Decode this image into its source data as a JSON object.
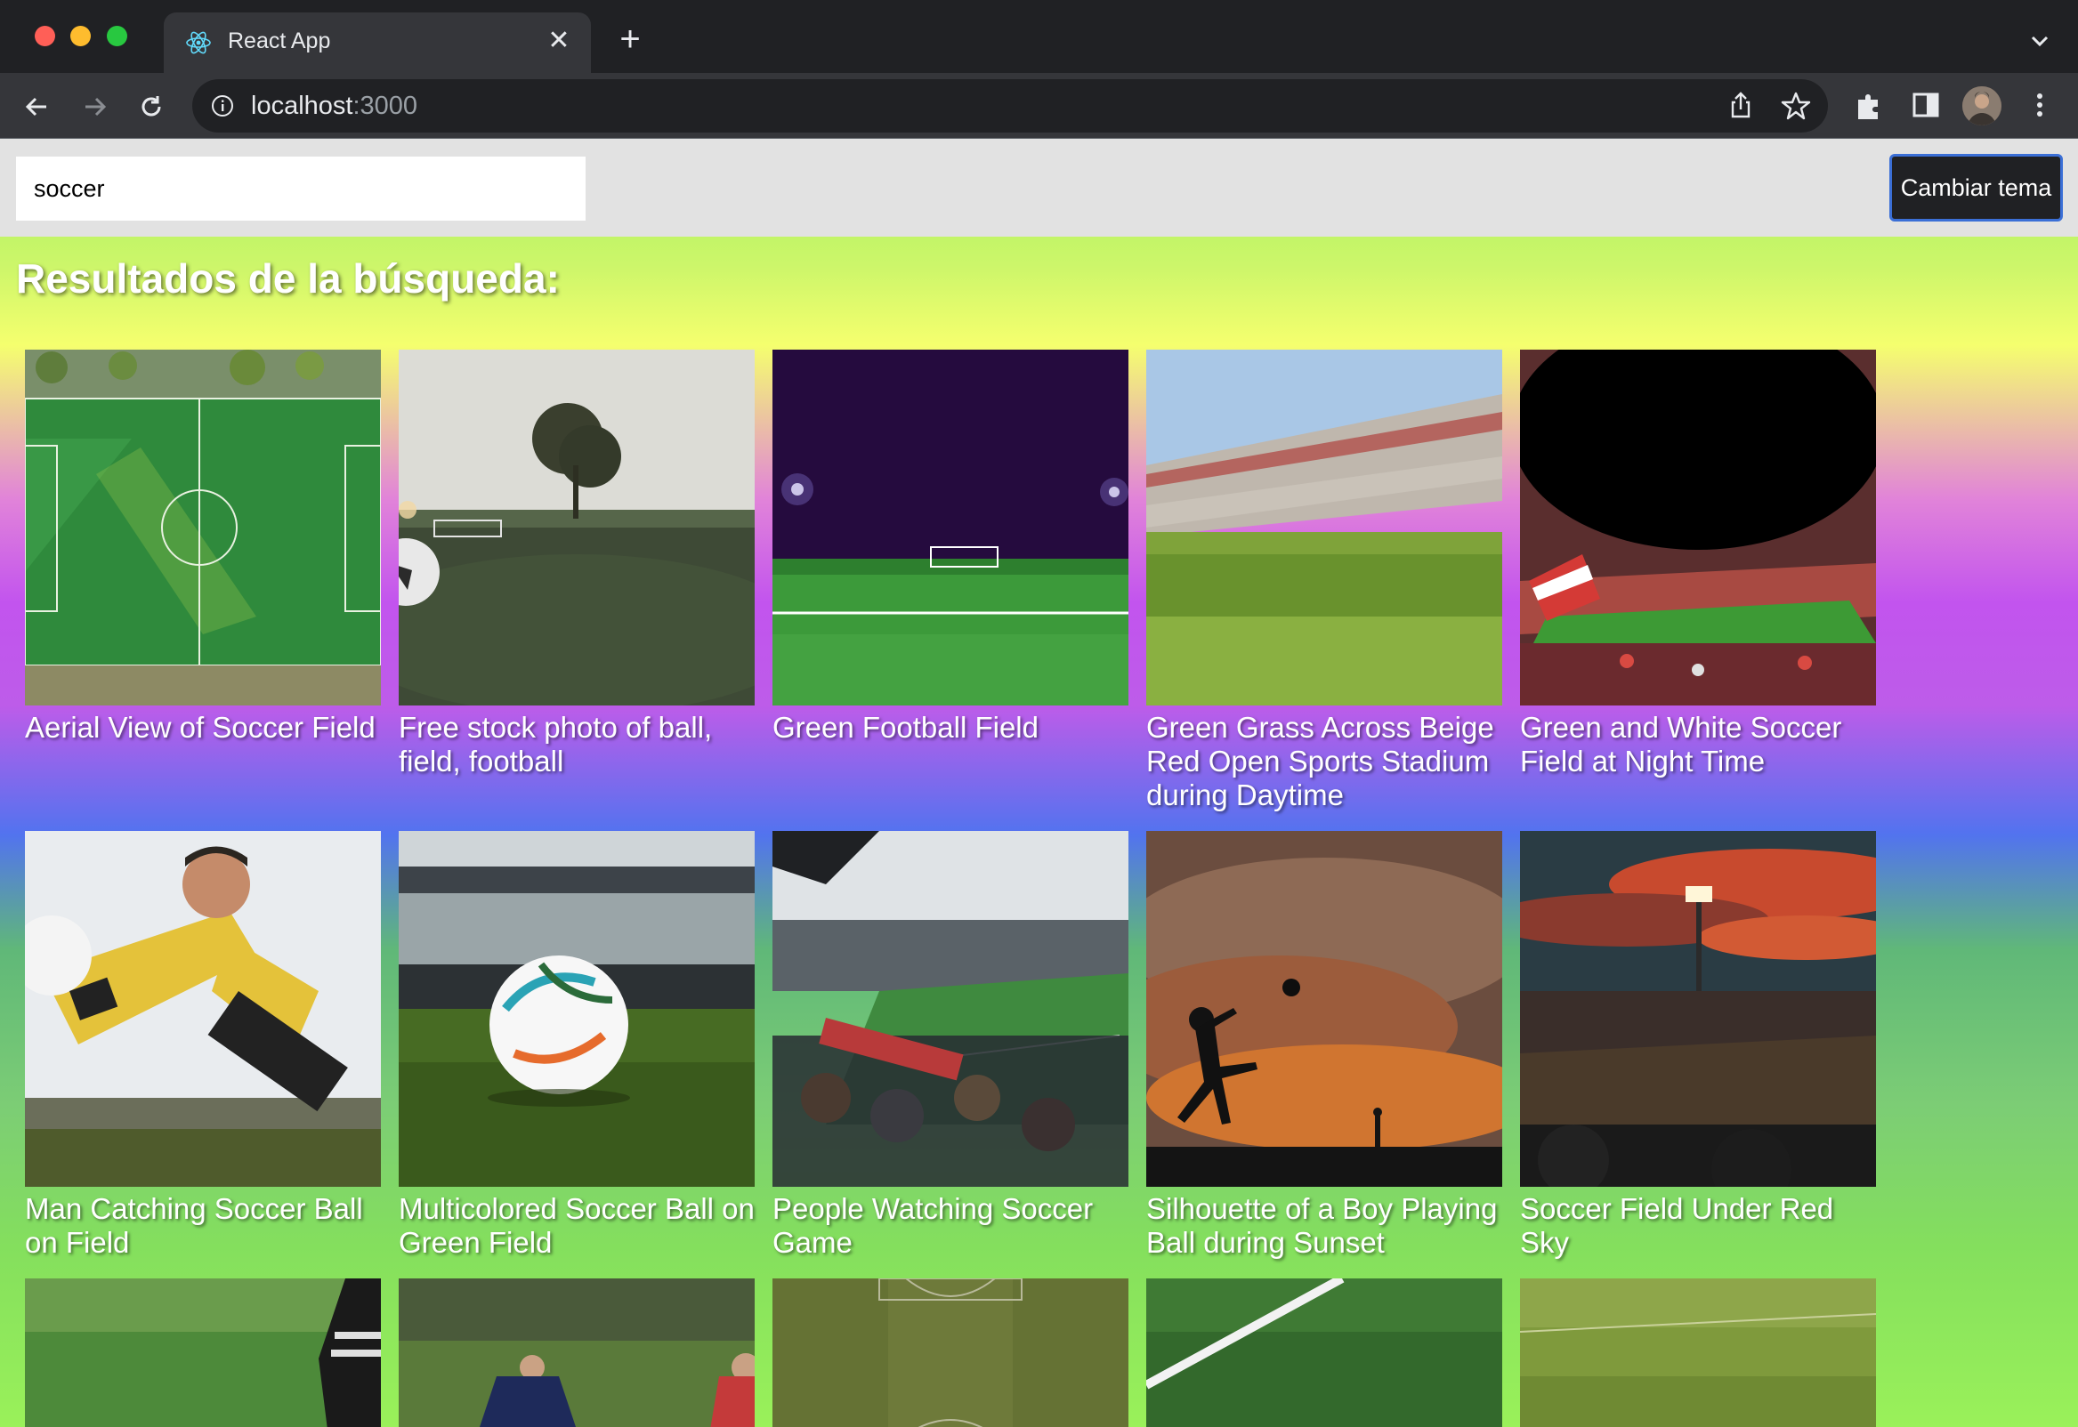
{
  "browser": {
    "tab_title": "React App",
    "url_host": "localhost",
    "url_port": ":3000"
  },
  "search": {
    "value": "soccer",
    "placeholder": ""
  },
  "theme_button_label": "Cambiar tema",
  "results_heading": "Resultados de la búsqueda:",
  "results": [
    {
      "title": "Aerial View of Soccer Field"
    },
    {
      "title": "Free stock photo of ball, field, football"
    },
    {
      "title": "Green Football Field"
    },
    {
      "title": "Green Grass Across Beige Red Open Sports Stadium during Daytime"
    },
    {
      "title": "Green and White Soccer Field at Night Time"
    },
    {
      "title": "Man Catching Soccer Ball on Field"
    },
    {
      "title": "Multicolored Soccer Ball on Green Field"
    },
    {
      "title": "People Watching Soccer Game"
    },
    {
      "title": "Silhouette of a Boy Playing Ball during Sunset"
    },
    {
      "title": "Soccer Field Under Red Sky"
    }
  ],
  "icons": [
    "react-logo-icon",
    "close-icon",
    "plus-icon",
    "chevron-down-icon",
    "back-arrow-icon",
    "forward-arrow-icon",
    "reload-icon",
    "info-icon",
    "share-icon",
    "star-icon",
    "extensions-icon",
    "side-panel-icon",
    "kebab-menu-icon"
  ],
  "colors": {
    "chrome_dark": "#202124",
    "chrome_toolbar": "#35363a",
    "search_bar_bg": "#e2e2e2",
    "button_border": "#3b6fd6"
  }
}
